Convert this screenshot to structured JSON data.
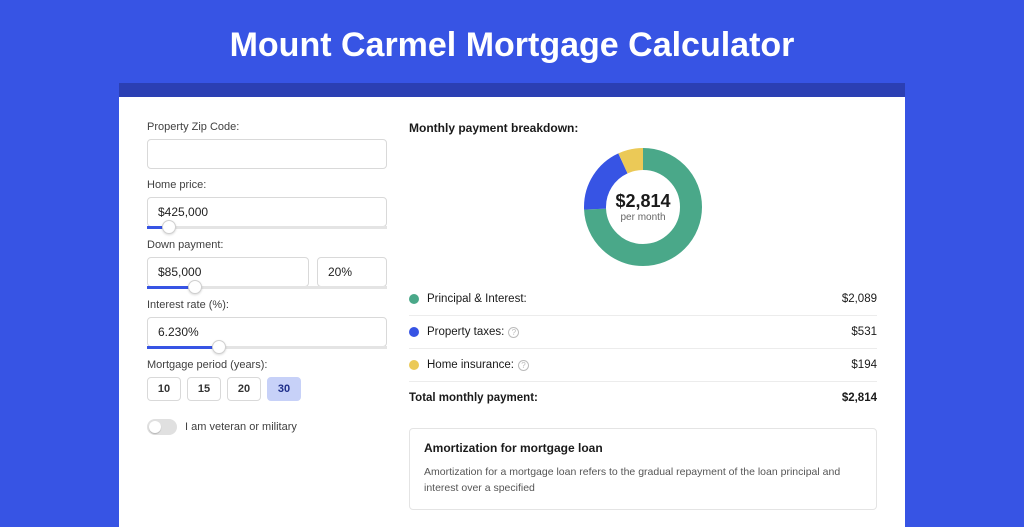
{
  "title": "Mount Carmel Mortgage Calculator",
  "form": {
    "zip_label": "Property Zip Code:",
    "zip_value": "",
    "home_price_label": "Home price:",
    "home_price_value": "$425,000",
    "home_price_slider_pct": 9,
    "down_payment_label": "Down payment:",
    "down_payment_value": "$85,000",
    "down_payment_pct": "20%",
    "down_payment_slider_pct": 20,
    "rate_label": "Interest rate (%):",
    "rate_value": "6.230%",
    "rate_slider_pct": 30,
    "period_label": "Mortgage period (years):",
    "periods": [
      "10",
      "15",
      "20",
      "30"
    ],
    "period_active": "30",
    "veteran_label": "I am veteran or military"
  },
  "breakdown": {
    "title": "Monthly payment breakdown:",
    "center_amount": "$2,814",
    "center_sub": "per month",
    "items": [
      {
        "label": "Principal & Interest:",
        "value": "$2,089",
        "color": "#4aa889",
        "has_info": false
      },
      {
        "label": "Property taxes:",
        "value": "$531",
        "color": "#3754e4",
        "has_info": true
      },
      {
        "label": "Home insurance:",
        "value": "$194",
        "color": "#ebc957",
        "has_info": true
      }
    ],
    "total_label": "Total monthly payment:",
    "total_value": "$2,814"
  },
  "chart_data": {
    "type": "pie",
    "title": "Monthly payment breakdown",
    "series": [
      {
        "name": "Principal & Interest",
        "value": 2089,
        "color": "#4aa889"
      },
      {
        "name": "Property taxes",
        "value": 531,
        "color": "#3754e4"
      },
      {
        "name": "Home insurance",
        "value": 194,
        "color": "#ebc957"
      }
    ],
    "total": 2814
  },
  "amort": {
    "title": "Amortization for mortgage loan",
    "body": "Amortization for a mortgage loan refers to the gradual repayment of the loan principal and interest over a specified"
  },
  "colors": {
    "green": "#4aa889",
    "blue": "#3754e4",
    "yellow": "#ebc957"
  }
}
